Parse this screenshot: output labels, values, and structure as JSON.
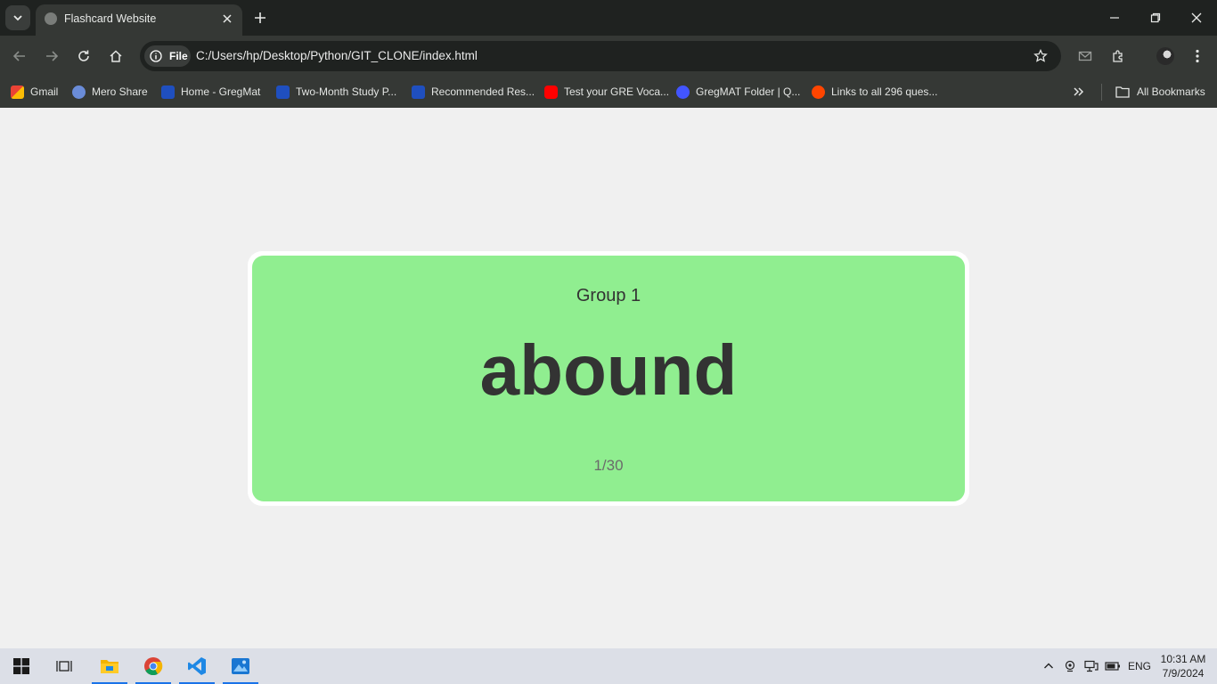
{
  "browser": {
    "tab_title": "Flashcard Website",
    "chip_label": "File",
    "url": "C:/Users/hp/Desktop/Python/GIT_CLONE/index.html",
    "bookmarks": [
      {
        "label": "Gmail",
        "icon": "gmail-icon",
        "color": "#ea4335"
      },
      {
        "label": "Mero Share",
        "icon": "mero-share-icon",
        "color": "#6a8cd8"
      },
      {
        "label": "Home - GregMat",
        "icon": "gregmat-icon",
        "color": "#1f4fbf"
      },
      {
        "label": "Two-Month Study P...",
        "icon": "gregmat-icon",
        "color": "#1f4fbf"
      },
      {
        "label": "Recommended Res...",
        "icon": "gregmat-icon",
        "color": "#1f4fbf"
      },
      {
        "label": "Test your GRE Voca...",
        "icon": "youtube-icon",
        "color": "#ff0000"
      },
      {
        "label": "GregMAT Folder | Q...",
        "icon": "quizlet-icon",
        "color": "#4255ff"
      },
      {
        "label": "Links to all 296 ques...",
        "icon": "reddit-icon",
        "color": "#ff4500"
      }
    ],
    "all_bookmarks_label": "All Bookmarks"
  },
  "flashcard": {
    "group": "Group 1",
    "word": "abound",
    "counter": "1/30",
    "card_color": "#90ee90"
  },
  "taskbar": {
    "language": "ENG",
    "time": "10:31 AM",
    "date": "7/9/2024"
  }
}
